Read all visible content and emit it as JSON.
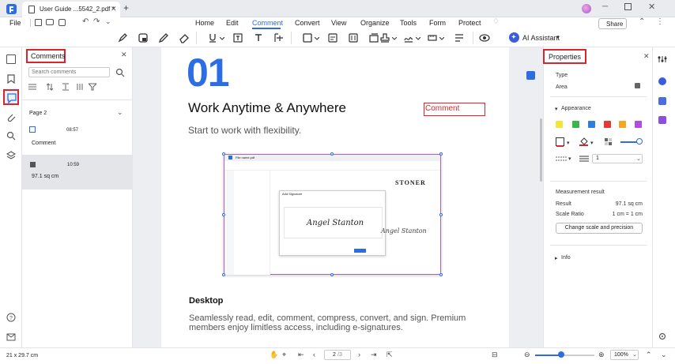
{
  "titlebar": {
    "tab_title": "User Guide ...5542_2.pdf *",
    "new_tab": "+"
  },
  "menubar": {
    "file": "File",
    "items": [
      "Home",
      "Edit",
      "Comment",
      "Convert",
      "View",
      "Organize",
      "Tools",
      "Form",
      "Protect"
    ],
    "active": "Comment",
    "share": "Share",
    "ai_assistant": "AI Assistant"
  },
  "comments_panel": {
    "title": "Comments",
    "search_placeholder": "Search comments",
    "page_label": "Page 2",
    "items": [
      {
        "time": "08:57",
        "text": "Comment"
      },
      {
        "time": "10:59",
        "text": "97.1 sq cm"
      }
    ]
  },
  "document": {
    "number": "01",
    "heading": "Work Anytime & Anywhere",
    "subheading": "Start to work with flexibility.",
    "comment_box": "Comment",
    "section_title": "Desktop",
    "body_line1": "Seamlessly read, edit, comment, compress, convert, and sign. Premium",
    "body_line2": "members enjoy limitless access, including e-signatures.",
    "thumb": {
      "file_label": "File name.pdf",
      "brand": "STONER",
      "dialog_title": "Add Signature",
      "signature": "Angel Stanton",
      "signature_right": "Angel Stanton"
    }
  },
  "properties_panel": {
    "title": "Properties",
    "type_label": "Type",
    "type_value": "Area",
    "appearance_label": "Appearance",
    "colors": [
      "#f2e535",
      "#3ab54a",
      "#2e7de1",
      "#e53935",
      "#f5a623",
      "#b34be0"
    ],
    "line_width": "1",
    "measurement_label": "Measurement result",
    "result_label": "Result",
    "result_value": "97.1 sq cm",
    "scale_label": "Scale Ratio",
    "scale_value": "1 cm = 1 cm",
    "scale_button": "Change scale and precision",
    "info_label": "Info"
  },
  "statusbar": {
    "page_size": "21 x 29.7 cm",
    "page_current": "2",
    "page_total": "/3",
    "zoom": "100%"
  },
  "accent": "#2d6de4",
  "highlight_red": "#d9262e"
}
